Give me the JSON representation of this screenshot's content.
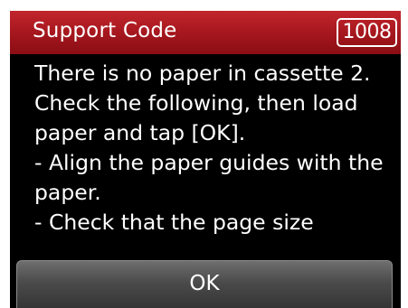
{
  "header": {
    "title": "Support Code",
    "code": "1008"
  },
  "message": {
    "lines": [
      "There is no paper in cassette 2.",
      "Check the following, then load",
      "paper and tap [OK].",
      "- Align the paper guides with the",
      "paper.",
      "- Check that the page size"
    ]
  },
  "footer": {
    "ok_label": "OK"
  },
  "colors": {
    "header_red": "#a4161d",
    "background": "#000000",
    "text": "#ffffff"
  }
}
